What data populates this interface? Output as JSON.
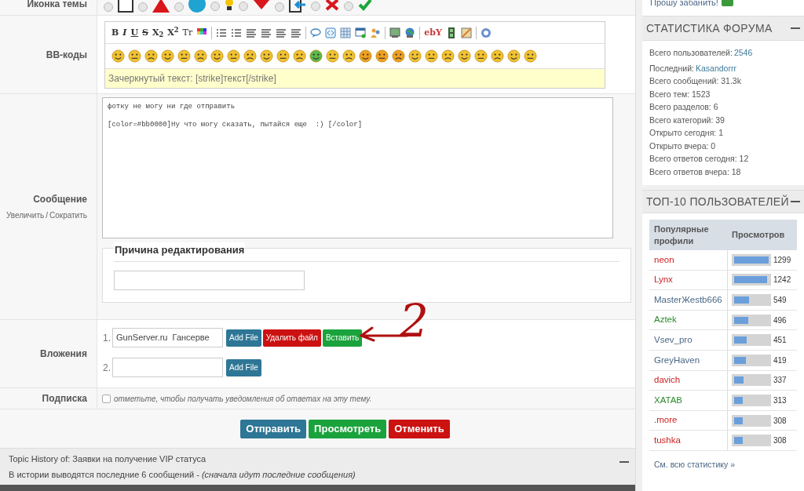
{
  "topic_icon_row": {
    "label": "Иконка темы",
    "options": [
      {
        "kind": "blank",
        "selected": false
      },
      {
        "kind": "warning",
        "selected": false
      },
      {
        "kind": "info",
        "selected": false
      },
      {
        "kind": "bulb",
        "selected": false
      },
      {
        "kind": "down",
        "selected": false
      },
      {
        "kind": "import",
        "selected": false
      },
      {
        "kind": "cross",
        "selected": false
      },
      {
        "kind": "check",
        "selected": false
      }
    ]
  },
  "bbcodes": {
    "label": "BB-коды",
    "toolbar": [
      {
        "kind": "text",
        "label": "B"
      },
      {
        "kind": "text",
        "label": "I"
      },
      {
        "kind": "text",
        "label": "U"
      },
      {
        "kind": "text",
        "label": "S"
      },
      {
        "kind": "text",
        "label": "X$_{2}$"
      },
      {
        "kind": "text",
        "label": "X$^{2}$"
      },
      {
        "kind": "text",
        "label": "Tr"
      },
      {
        "kind": "icon"
      },
      {
        "kind": "sep"
      },
      {
        "kind": "icon"
      },
      {
        "kind": "icon"
      },
      {
        "kind": "icon"
      },
      {
        "kind": "icon"
      },
      {
        "kind": "icon"
      },
      {
        "kind": "icon"
      },
      {
        "kind": "sep"
      },
      {
        "kind": "icon"
      },
      {
        "kind": "icon"
      },
      {
        "kind": "icon"
      },
      {
        "kind": "icon"
      },
      {
        "kind": "icon"
      },
      {
        "kind": "sep"
      },
      {
        "kind": "icon"
      },
      {
        "kind": "icon"
      },
      {
        "kind": "sep"
      },
      {
        "kind": "text",
        "label": "ebY"
      },
      {
        "kind": "icon"
      },
      {
        "kind": "icon"
      },
      {
        "kind": "sep"
      },
      {
        "kind": "icon"
      }
    ],
    "hint": "Зачеркнутый текст: [strike]текст[/strike]"
  },
  "message": {
    "label": "Сообщение",
    "enlarge": "Увеличить",
    "slash": "/",
    "shrink": "Сократить",
    "value": "фотку не могу ни где отправить\n\n[color=#bb0000]Ну что могу сказать, пытайся еще  :) [/color]"
  },
  "edit_reason": {
    "legend": "Причина редактирования"
  },
  "attachments": {
    "label": "Вложения",
    "files": [
      {
        "number": "1.",
        "value": "GunServer.ru  Гансерве",
        "buttons": [
          {
            "kind": "add",
            "label": "Add File"
          },
          {
            "kind": "delete",
            "label": "Удалить файл"
          },
          {
            "kind": "insert",
            "label": "Вставить"
          }
        ]
      },
      {
        "number": "2.",
        "buttons": [
          {
            "kind": "add",
            "label": "Add File"
          }
        ]
      }
    ],
    "annotation": "2"
  },
  "subscription": {
    "label": "Подписка",
    "checked": false,
    "text": "отметьте, чтобы получать уведомления об ответах на эту тему."
  },
  "actions": [
    {
      "kind": "submit",
      "label": "Отправить"
    },
    {
      "kind": "preview",
      "label": "Просмотреть"
    },
    {
      "kind": "cancel",
      "label": "Отменить"
    }
  ],
  "topic_history": {
    "title": "Topic History of: Заявки на получение VIP статуса",
    "note": "В истории выводятся последние 6 сообщений - ",
    "note_italic": "(сначала идут последние сообщения)"
  },
  "sidebar": {
    "top_link": "Прошу забанить!",
    "stats": {
      "title": "СТАТИСТИКА ФОРУМА",
      "items": [
        {
          "label": "Всего пользователей: ",
          "link": "2546"
        },
        {
          "label": "Последний: ",
          "link": "Kasandorrr"
        },
        {
          "label": "Всего сообщений: 31.3k"
        },
        {
          "label": "Всего тем: 1523"
        },
        {
          "label": "Всего разделов: 6"
        },
        {
          "label": "Всего категорий: 39"
        },
        {
          "label": "Открыто сегодня: 1"
        },
        {
          "label": "Открыто вчера: 0"
        },
        {
          "label": "Всего ответов сегодня: 12"
        },
        {
          "label": "Всего ответов вчера: 18"
        }
      ]
    },
    "top10": {
      "title": "ТОП-10 ПОЛЬЗОВАТЕЛЕЙ",
      "columns": [
        "Популярные профили",
        "Просмотров"
      ],
      "rows": [
        {
          "name": "neon",
          "color": "#cc2222",
          "views": "1299",
          "level": 1.0
        },
        {
          "name": "Lynx",
          "color": "#cc2222",
          "views": "1242",
          "level": 0.96
        },
        {
          "name": "MasterЖestb666",
          "color": "#4a6785",
          "views": "549",
          "level": 0.44
        },
        {
          "name": "Aztek",
          "color": "#2e8b2e",
          "views": "496",
          "level": 0.4
        },
        {
          "name": "Vsev_pro",
          "color": "#4a6785",
          "views": "451",
          "level": 0.36
        },
        {
          "name": "GreyHaven",
          "color": "#4a6785",
          "views": "419",
          "level": 0.34
        },
        {
          "name": "davich",
          "color": "#cc2222",
          "views": "337",
          "level": 0.28
        },
        {
          "name": "XATAB",
          "color": "#2e8b2e",
          "views": "313",
          "level": 0.26
        },
        {
          "name": ".more",
          "color": "#cc2222",
          "views": "308",
          "level": 0.25
        },
        {
          "name": "tushka",
          "color": "#cc2222",
          "views": "308",
          "level": 0.25
        }
      ],
      "more": "См. всю статистику »"
    }
  }
}
